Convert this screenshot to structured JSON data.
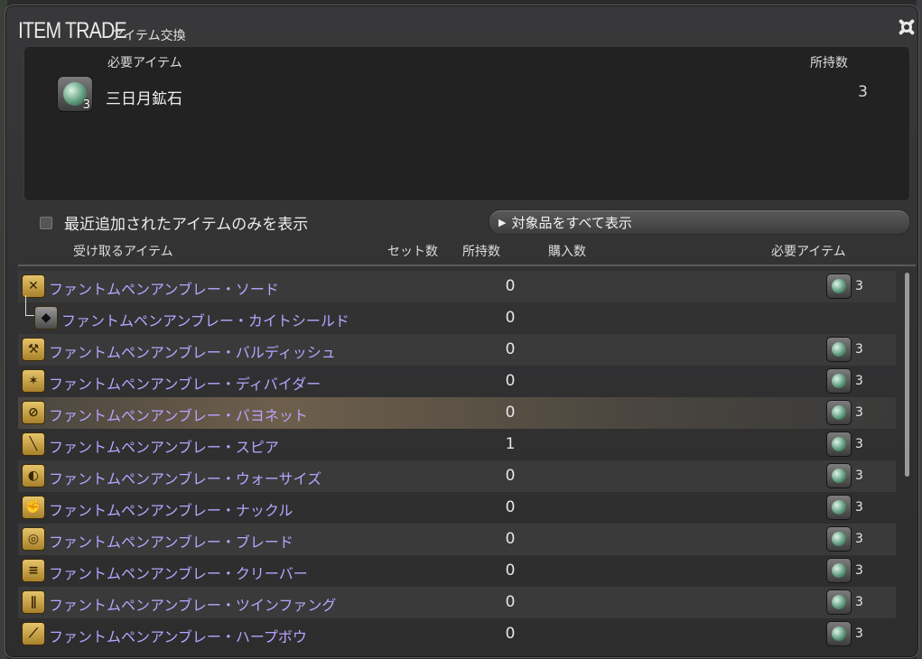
{
  "window": {
    "title": "ITEM TRADE",
    "subtitle": "アイテム交換"
  },
  "required_panel": {
    "header_item": "必要アイテム",
    "header_owned": "所持数",
    "item_name": "三日月鉱石",
    "item_qty_badge": "3",
    "owned": "3",
    "item_icon": "crescent-ore-icon"
  },
  "filter": {
    "checkbox_label": "最近追加されたアイテムのみを表示",
    "checked": false,
    "show_all_label": "対象品をすべて表示"
  },
  "columns": {
    "receive": "受け取るアイテム",
    "sets": "セット数",
    "owned": "所持数",
    "purchase": "購入数",
    "required": "必要アイテム"
  },
  "rows": [
    {
      "name": "ファントムペンアンブレー・ソード",
      "owned": "0",
      "req_qty": "3",
      "icon": "sword-icon",
      "glyph": "✕"
    },
    {
      "name": "ファントムペンアンブレー・カイトシールド",
      "owned": "0",
      "req_qty": "",
      "icon": "shield-icon",
      "glyph": "◆"
    },
    {
      "name": "ファントムペンアンブレー・バルディッシュ",
      "owned": "0",
      "req_qty": "3",
      "icon": "axe-icon",
      "glyph": "⚒"
    },
    {
      "name": "ファントムペンアンブレー・ディバイダー",
      "owned": "0",
      "req_qty": "3",
      "icon": "greatsword-icon",
      "glyph": "✶"
    },
    {
      "name": "ファントムペンアンブレー・バヨネット",
      "owned": "0",
      "req_qty": "3",
      "icon": "gunblade-icon",
      "glyph": "⊘"
    },
    {
      "name": "ファントムペンアンブレー・スピア",
      "owned": "1",
      "req_qty": "3",
      "icon": "spear-icon",
      "glyph": "╲"
    },
    {
      "name": "ファントムペンアンブレー・ウォーサイズ",
      "owned": "0",
      "req_qty": "3",
      "icon": "scythe-icon",
      "glyph": "◐"
    },
    {
      "name": "ファントムペンアンブレー・ナックル",
      "owned": "0",
      "req_qty": "3",
      "icon": "knuckle-icon",
      "glyph": "✊"
    },
    {
      "name": "ファントムペンアンブレー・ブレード",
      "owned": "0",
      "req_qty": "3",
      "icon": "blade-icon",
      "glyph": "◎"
    },
    {
      "name": "ファントムペンアンブレー・クリーバー",
      "owned": "0",
      "req_qty": "3",
      "icon": "cleaver-icon",
      "glyph": "≡"
    },
    {
      "name": "ファントムペンアンブレー・ツインファング",
      "owned": "0",
      "req_qty": "3",
      "icon": "twin-fang-icon",
      "glyph": "∥"
    },
    {
      "name": "ファントムペンアンブレー・ハープボウ",
      "owned": "0",
      "req_qty": "3",
      "icon": "bow-icon",
      "glyph": "⟋"
    }
  ]
}
